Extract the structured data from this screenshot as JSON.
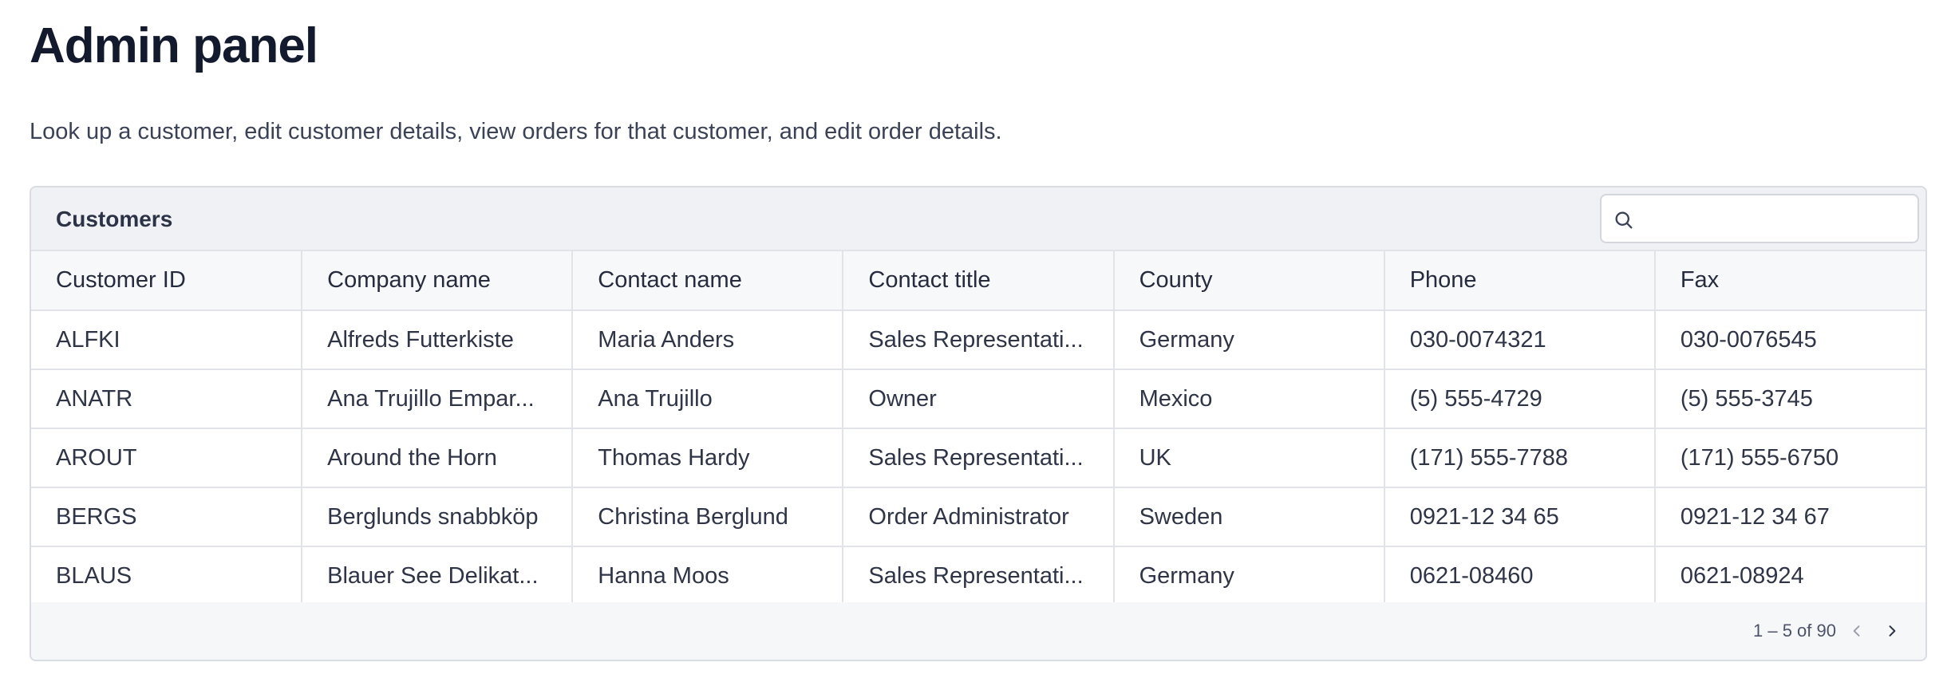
{
  "page": {
    "title": "Admin panel",
    "description": "Look up a customer, edit customer details, view orders for that customer, and edit order details."
  },
  "customers": {
    "title": "Customers",
    "search": {
      "value": "",
      "placeholder": "",
      "icon": "search-icon"
    },
    "columns": [
      "Customer ID",
      "Company name",
      "Contact name",
      "Contact title",
      "County",
      "Phone",
      "Fax"
    ],
    "rows": [
      [
        "ALFKI",
        "Alfreds Futterkiste",
        "Maria Anders",
        "Sales Representati...",
        "Germany",
        "030-0074321",
        "030-0076545"
      ],
      [
        "ANATR",
        "Ana Trujillo Empar...",
        "Ana Trujillo",
        "Owner",
        "Mexico",
        "(5) 555-4729",
        "(5) 555-3745"
      ],
      [
        "AROUT",
        "Around the Horn",
        "Thomas Hardy",
        "Sales Representati...",
        "UK",
        "(171) 555-7788",
        "(171) 555-6750"
      ],
      [
        "BERGS",
        "Berglunds snabbköp",
        "Christina Berglund",
        "Order Administrator",
        "Sweden",
        "0921-12 34 65",
        "0921-12 34 67"
      ],
      [
        "BLAUS",
        "Blauer See Delikat...",
        "Hanna Moos",
        "Sales Representati...",
        "Germany",
        "0621-08460",
        "0621-08924"
      ]
    ],
    "pagination": {
      "label": "1 – 5 of 90",
      "prev_icon": "chevron-left-icon",
      "next_icon": "chevron-right-icon"
    }
  },
  "colors": {
    "title": "#141a2e",
    "text": "#2f3547",
    "border": "#e1e3e8",
    "header_bg": "#f0f1f4"
  }
}
